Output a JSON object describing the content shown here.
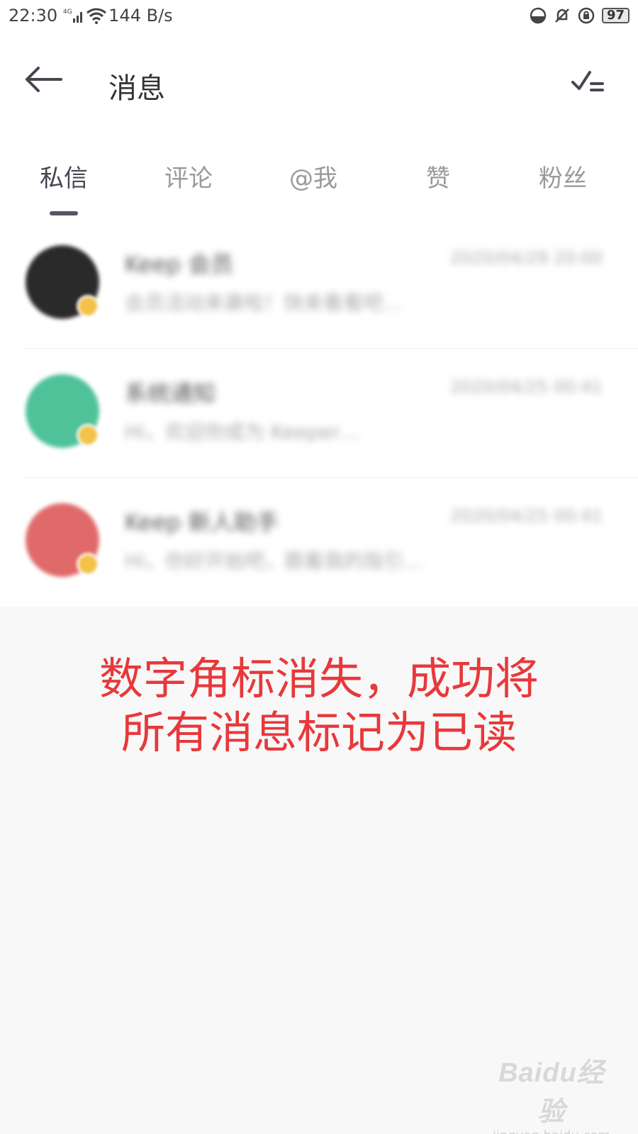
{
  "status_bar": {
    "time": "22:30",
    "network": "4G",
    "speed": "144 B/s",
    "battery": "97",
    "icons": [
      "signal-icon",
      "wifi-icon",
      "data-saver-icon",
      "mute-icon",
      "rotation-lock-icon",
      "battery-icon"
    ]
  },
  "header": {
    "title": "消息",
    "back_icon": "back-arrow-icon",
    "action_icon": "mark-all-read-icon"
  },
  "tabs": [
    {
      "label": "私信",
      "active": true
    },
    {
      "label": "评论",
      "active": false
    },
    {
      "label": "@我",
      "active": false
    },
    {
      "label": "赞",
      "active": false
    },
    {
      "label": "粉丝",
      "active": false
    }
  ],
  "messages": [
    {
      "name": "Keep 会员",
      "time": "2020/04/29 20:00",
      "preview": "会员活动来袭啦！快来看看吧…",
      "avatar_color": "#2a2a2a"
    },
    {
      "name": "系统通知",
      "time": "2020/04/25 00:41",
      "preview": "Hi，欢迎你成为 Keeper…",
      "avatar_color": "#4fc29a"
    },
    {
      "name": "Keep 新人助手",
      "time": "2020/04/25 00:41",
      "preview": "Hi，你好开始吧，跟着我的指引…",
      "avatar_color": "#e06a6a"
    }
  ],
  "annotation": {
    "line1": "数字角标消失，成功将",
    "line2": "所有消息标记为已读"
  },
  "watermark": {
    "logo": "Baidu经验",
    "url": "jingyan.baidu.com"
  },
  "colors": {
    "accent": "#4a4452",
    "annotation": "#e8383b",
    "badge": "#f3c24a"
  }
}
